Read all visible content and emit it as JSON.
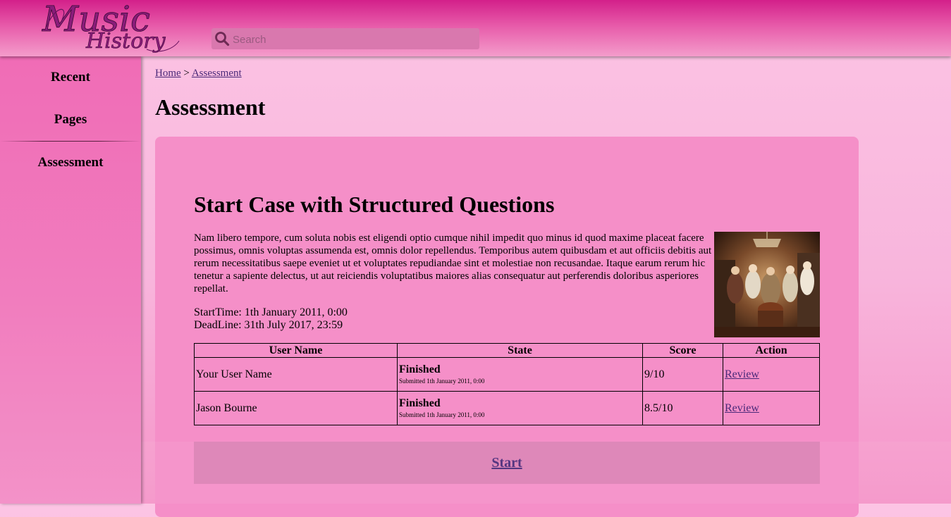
{
  "header": {
    "logo_text_1": "Music",
    "logo_text_2": "History",
    "search_placeholder": "Search",
    "colors": {
      "header_dark": "#d3208a",
      "header_light": "#f49ccb"
    }
  },
  "sidebar": {
    "items": [
      {
        "label": "Recent"
      },
      {
        "label": "Pages"
      },
      {
        "label": "Assessment"
      }
    ]
  },
  "breadcrumb": {
    "home": "Home",
    "separator": ">",
    "current": "Assessment"
  },
  "page_title": "Assessment",
  "case": {
    "title": "Start Case with Structured Questions",
    "description": "Nam libero tempore, cum soluta nobis est eligendi optio cumque nihil impedit quo minus id quod maxime placeat facere possimus, omnis voluptas assumenda est, omnis dolor repellendus. Temporibus autem quibusdam et aut officiis debitis aut rerum necessitatibus saepe eveniet ut et voluptates repudiandae sint et molestiae non recusandae. Itaque earum rerum hic tenetur a sapiente delectus, ut aut reiciendis voluptatibus maiores alias consequatur aut perferendis doloribus asperiores repellat.",
    "start_time": "StartTime: 1th January 2011, 0:00",
    "deadline": "DeadLine: 31th July 2017, 23:59",
    "image_icon": "classical-music-painting"
  },
  "table": {
    "headers": [
      "User Name",
      "State",
      "Score",
      "Action"
    ],
    "rows": [
      {
        "user": "Your User Name",
        "state": "Finished",
        "submitted": "Submitted 1th January 2011, 0:00",
        "score": "9/10",
        "action": "Review"
      },
      {
        "user": "Jason Bourne",
        "state": "Finished",
        "submitted": "Submitted 1th January 2011, 0:00",
        "score": "8.5/10",
        "action": "Review"
      }
    ]
  },
  "start_label": "Start",
  "colors": {
    "panel": "#f58fc8",
    "link": "#4b2a7a",
    "start_bar": "#dc81b5"
  }
}
